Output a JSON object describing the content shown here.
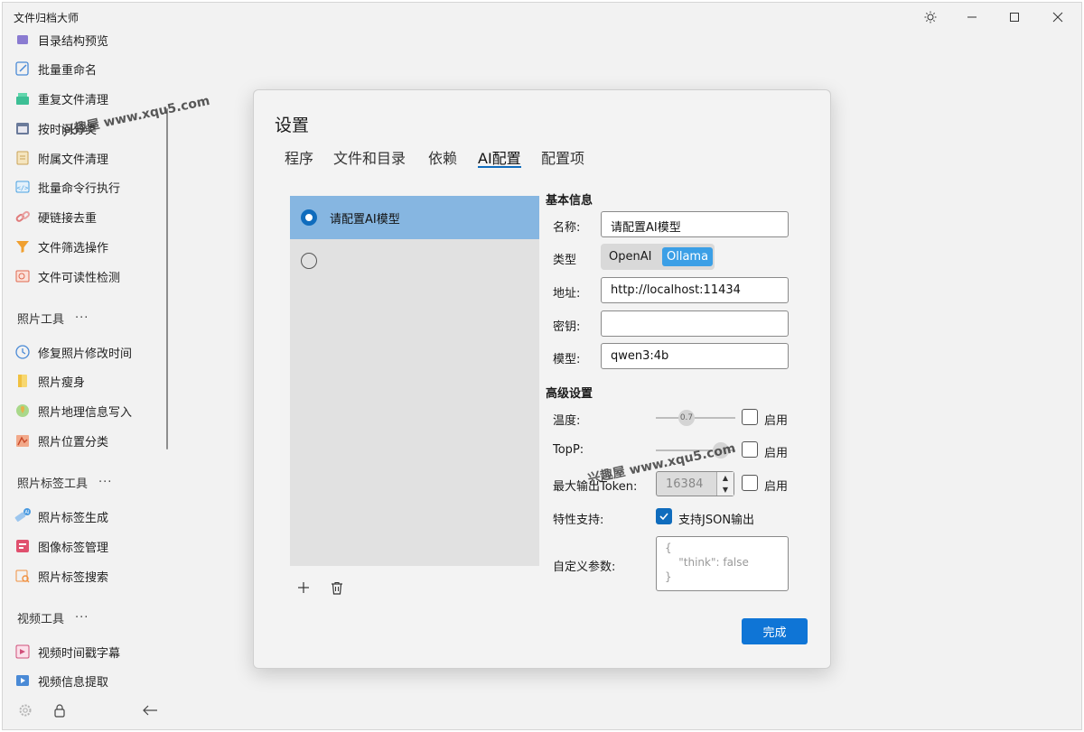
{
  "app": {
    "title": "文件归档大师",
    "titlebar_buttons": [
      "theme-toggle",
      "minimize",
      "maximize",
      "close"
    ]
  },
  "sidebar": {
    "items": [
      {
        "label": "目录结构预览",
        "icon": "folder-tree-icon",
        "color": "#8a7bd1"
      },
      {
        "label": "批量重命名",
        "icon": "pencil-icon",
        "color": "#4a8ad6"
      },
      {
        "label": "重复文件清理",
        "icon": "broom-icon",
        "color": "#3dbf95"
      },
      {
        "label": "按时间分类",
        "icon": "calendar-icon",
        "color": "#7a7aa0"
      },
      {
        "label": "附属文件清理",
        "icon": "file-icon",
        "color": "#c9a357"
      },
      {
        "label": "批量命令行执行",
        "icon": "terminal-icon",
        "color": "#4aa1e2"
      },
      {
        "label": "硬链接去重",
        "icon": "link-icon",
        "color": "#e07b7b"
      },
      {
        "label": "文件筛选操作",
        "icon": "filter-icon",
        "color": "#f0a030"
      },
      {
        "label": "文件可读性检测",
        "icon": "inspect-icon",
        "color": "#e0684f"
      }
    ],
    "sections": [
      {
        "title": "照片工具",
        "more": "···",
        "items": [
          {
            "label": "修复照片修改时间",
            "icon": "clock-icon",
            "color": "#4a8ad6"
          },
          {
            "label": "照片瘦身",
            "icon": "photo-compress-icon",
            "color": "#f0c040"
          },
          {
            "label": "照片地理信息写入",
            "icon": "map-pin-icon",
            "color": "#7fbf5a"
          },
          {
            "label": "照片位置分类",
            "icon": "map-grid-icon",
            "color": "#e07a4a"
          }
        ]
      },
      {
        "title": "照片标签工具",
        "more": "···",
        "items": [
          {
            "label": "照片标签生成",
            "icon": "ai-tag-icon",
            "color": "#4a9ae0"
          },
          {
            "label": "图像标签管理",
            "icon": "tag-manage-icon",
            "color": "#e0506e"
          },
          {
            "label": "照片标签搜索",
            "icon": "tag-search-icon",
            "color": "#f09040"
          }
        ]
      },
      {
        "title": "视频工具",
        "more": "···",
        "items": [
          {
            "label": "视频时间戳字幕",
            "icon": "subtitle-icon",
            "color": "#d0507a"
          },
          {
            "label": "视频信息提取",
            "icon": "video-info-icon",
            "color": "#4a8ad6"
          }
        ]
      }
    ]
  },
  "dialog": {
    "title": "设置",
    "tabs": [
      "程序",
      "文件和目录",
      "依赖",
      "AI配置",
      "配置项"
    ],
    "active_tab": "AI配置",
    "model_list": [
      {
        "label": "请配置AI模型",
        "selected": true
      },
      {
        "label": "",
        "selected": false
      }
    ],
    "basic_section": "基本信息",
    "fields": {
      "name_label": "名称:",
      "name_value": "请配置AI模型",
      "type_label": "类型",
      "type_options": [
        "OpenAI",
        "Ollama"
      ],
      "type_selected": "Ollama",
      "address_label": "地址:",
      "address_value": "http://localhost:11434",
      "key_label": "密钥:",
      "key_value": "",
      "model_label": "模型:",
      "model_value": "qwen3:4b"
    },
    "advanced_section": "高级设置",
    "advanced": {
      "temperature_label": "温度:",
      "temperature_value": "0.7",
      "temperature_enable": "启用",
      "top_p_label": "TopP:",
      "top_p_enable": "启用",
      "max_token_label": "最大输出Token:",
      "max_token_value": "16384",
      "max_token_enable": "启用",
      "features_label": "特性支持:",
      "json_output_label": "支持JSON输出",
      "json_output_checked": true,
      "custom_params_label": "自定义参数:",
      "custom_params_value": "{\n    \"think\": false\n}"
    },
    "done_button": "完成"
  },
  "watermarks": [
    "兴趣屋 www.xqu5.com",
    "兴趣屋 www.xqu5.com"
  ],
  "colors": {
    "accent": "#0f6cbd",
    "selected_row": "#86b6e1",
    "segment_selected": "#3b9fe6"
  }
}
